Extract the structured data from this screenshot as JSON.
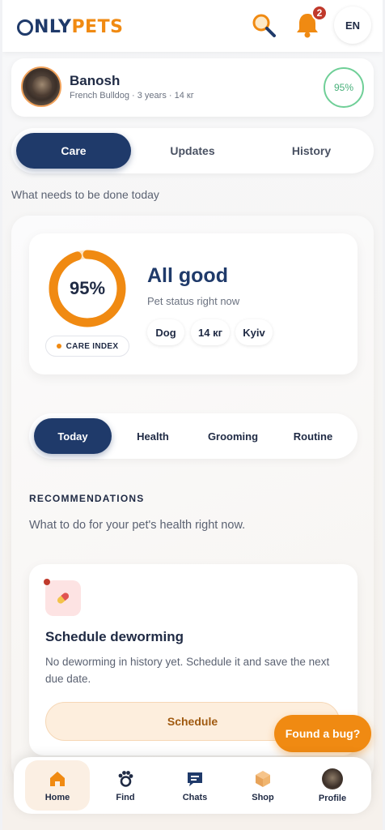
{
  "header": {
    "logo_only": "NLY",
    "logo_pets": "PETS",
    "notification_count": "2",
    "language": "EN"
  },
  "pet": {
    "name": "Banosh",
    "meta": "French Bulldog · 3 years · 14 кг",
    "score": "95%"
  },
  "main_tabs": [
    {
      "label": "Care",
      "active": true
    },
    {
      "label": "Updates",
      "active": false
    },
    {
      "label": "History",
      "active": false
    }
  ],
  "intro": "What needs to be done today",
  "status": {
    "percent_label": "95%",
    "percent_value": 95,
    "care_index_label": "CARE INDEX",
    "title": "All good",
    "subtitle": "Pet status right now",
    "chips": [
      "Dog",
      "14 кг",
      "Kyiv"
    ]
  },
  "sub_tabs": [
    {
      "label": "Today",
      "active": true
    },
    {
      "label": "Health",
      "active": false
    },
    {
      "label": "Grooming",
      "active": false
    },
    {
      "label": "Routine",
      "active": false
    }
  ],
  "recommendations": {
    "heading": "RECOMMENDATIONS",
    "subheading": "What to do for your pet's health right now.",
    "card": {
      "icon": "pill-icon",
      "title": "Schedule deworming",
      "description": "No deworming in history yet. Schedule it and save the next due date.",
      "button": "Schedule"
    }
  },
  "bug_button": "Found a bug?",
  "bottom_nav": [
    {
      "label": "Home",
      "icon": "home-icon",
      "active": true
    },
    {
      "label": "Find",
      "icon": "paw-icon",
      "active": false
    },
    {
      "label": "Chats",
      "icon": "chat-icon",
      "active": false
    },
    {
      "label": "Shop",
      "icon": "box-icon",
      "active": false
    },
    {
      "label": "Profile",
      "icon": "avatar",
      "active": false
    }
  ],
  "colors": {
    "brand_navy": "#1f3a6a",
    "brand_orange": "#f08a12",
    "status_green": "#6fcf97",
    "alert_red": "#c0392b"
  }
}
